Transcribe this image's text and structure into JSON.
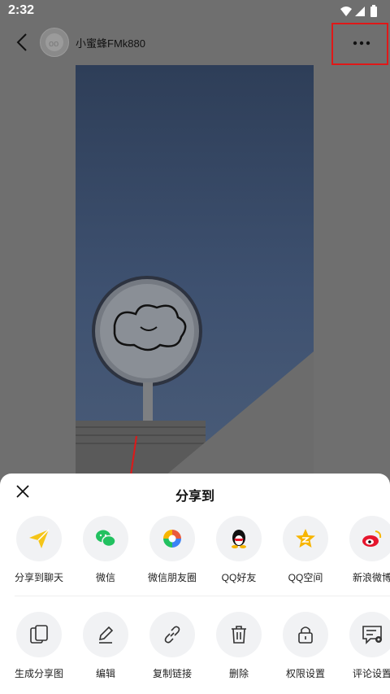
{
  "status_bar": {
    "time": "2:32"
  },
  "header": {
    "username": "小蜜蜂FMk880"
  },
  "share_sheet": {
    "title": "分享到",
    "row1": [
      {
        "label": "分享到聊天",
        "icon": "paper-plane-icon",
        "color": "#f5c518"
      },
      {
        "label": "微信",
        "icon": "wechat-icon",
        "color": "#22c160"
      },
      {
        "label": "微信朋友圈",
        "icon": "moments-icon",
        "color": "#ea5a3c"
      },
      {
        "label": "QQ好友",
        "icon": "qq-penguin-icon",
        "color": "#000000"
      },
      {
        "label": "QQ空间",
        "icon": "qzone-star-icon",
        "color": "#f7b500"
      },
      {
        "label": "新浪微博",
        "icon": "weibo-icon",
        "color": "#e6162d"
      }
    ],
    "row2": [
      {
        "label": "生成分享图",
        "icon": "share-image-icon"
      },
      {
        "label": "编辑",
        "icon": "pencil-icon"
      },
      {
        "label": "复制链接",
        "icon": "link-icon"
      },
      {
        "label": "删除",
        "icon": "trash-icon"
      },
      {
        "label": "权限设置",
        "icon": "lock-icon"
      },
      {
        "label": "评论设置",
        "icon": "comment-settings-icon"
      }
    ]
  },
  "annotation_color": "#e01818"
}
